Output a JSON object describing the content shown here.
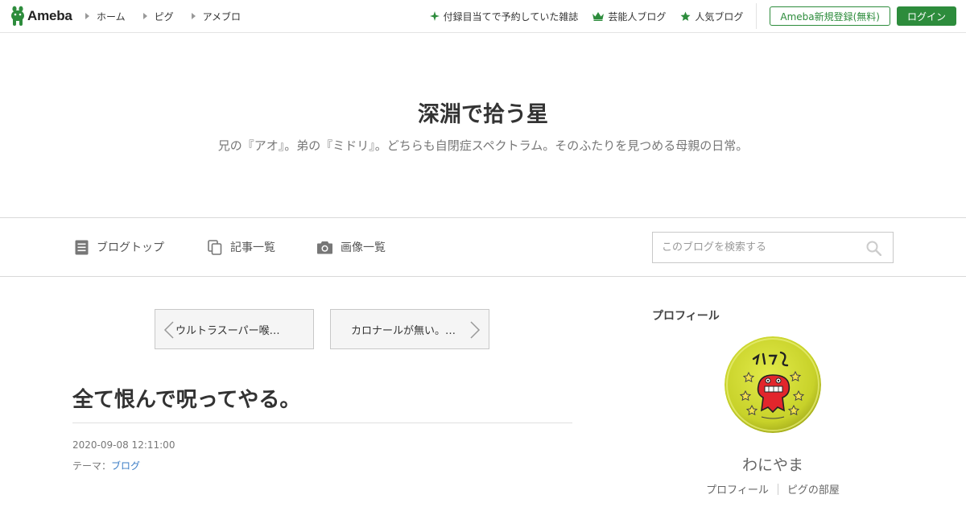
{
  "topbar": {
    "logo_text": "Ameba",
    "nav": [
      {
        "label": "ホーム"
      },
      {
        "label": "ピグ"
      },
      {
        "label": "アメブロ"
      }
    ],
    "links": [
      {
        "label": "付録目当てで予約していた雑誌",
        "icon": "sparkle-icon"
      },
      {
        "label": "芸能人ブログ",
        "icon": "crown-icon"
      },
      {
        "label": "人気ブログ",
        "icon": "star-icon"
      }
    ],
    "register_label": "Ameba新規登録(無料)",
    "login_label": "ログイン"
  },
  "blog": {
    "title": "深淵で拾う星",
    "description": "兄の『アオ』。弟の『ミドリ』。どちらも自閉症スペクトラム。そのふたりを見つめる母親の日常。"
  },
  "blog_nav": {
    "items": [
      {
        "label": "ブログトップ",
        "icon": "document-icon"
      },
      {
        "label": "記事一覧",
        "icon": "copy-icon"
      },
      {
        "label": "画像一覧",
        "icon": "camera-icon"
      }
    ],
    "search_placeholder": "このブログを検索する"
  },
  "pager": {
    "prev_label": "ウルトラスーパー喉…",
    "next_label": "カロナールが無い。…"
  },
  "entry": {
    "title": "全て恨んで呪ってやる。",
    "date": "2020-09-08 12:11:00",
    "theme_prefix": "テーマ：",
    "theme_label": "ブログ"
  },
  "sidebar": {
    "heading": "プロフィール",
    "name": "わにやま",
    "links": [
      {
        "label": "プロフィール"
      },
      {
        "label": "ピグの部屋"
      }
    ]
  },
  "colors": {
    "accent": "#2d8c3c",
    "link": "#3a7cc5"
  }
}
